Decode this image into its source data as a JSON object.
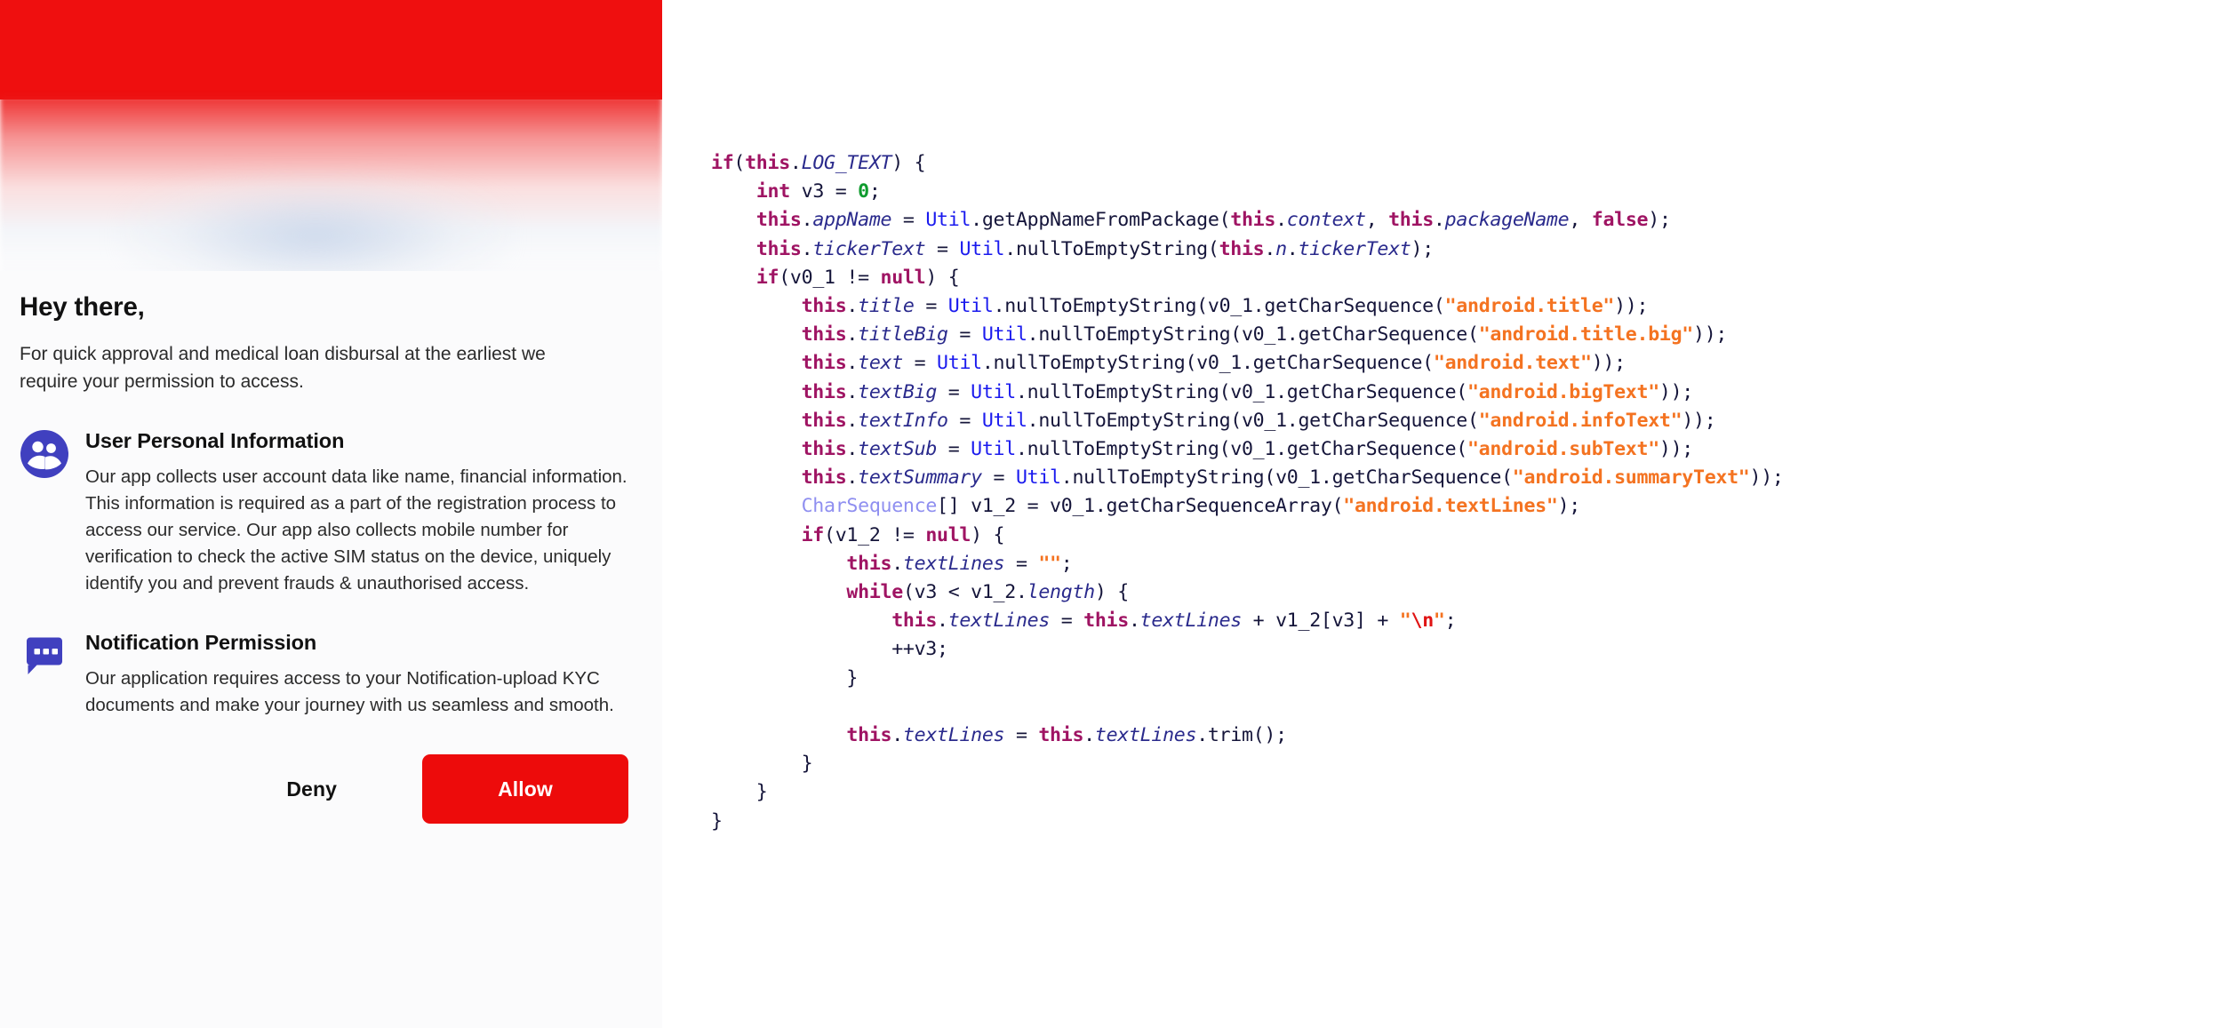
{
  "phone": {
    "hero": {
      "color": "#ef0f0f",
      "name": "red-gradient-banner"
    },
    "sheet": {
      "title": "Hey there,",
      "subtitle": "For quick approval and medical loan disbursal at the earliest we require your permission to access.",
      "permissions": [
        {
          "icon": "group-people-icon",
          "icon_color": "#4040bf",
          "heading": "User Personal Information",
          "description": "Our app collects user account data like name, financial information. This information is required as a part of the registration process to access our service. Our app also collects mobile number for verification to check the active SIM status on the device, uniquely identify you and prevent frauds & unauthorised access."
        },
        {
          "icon": "speech-bubble-dots-icon",
          "icon_color": "#4040bf",
          "heading": "Notification Permission",
          "description": "Our application requires access to your Notification-upload KYC documents and make your journey with us seamless and smooth."
        }
      ],
      "actions": {
        "deny_label": "Deny",
        "allow_label": "Allow",
        "allow_color": "#ed0b0b"
      }
    }
  },
  "code": {
    "language": "java",
    "colors": {
      "keyword": "#9f1463",
      "field": "#2a2a8c",
      "class": "#1a1aee",
      "type": "#8f8ff0",
      "string": "#f47321",
      "escape": "#e01414",
      "number": "#0f9b2e",
      "plain": "#15153a",
      "background": "#ffffff"
    },
    "lines": [
      [
        {
          "t": "kw",
          "v": "if"
        },
        {
          "t": "pl",
          "v": "("
        },
        {
          "t": "kw",
          "v": "this"
        },
        {
          "t": "pl",
          "v": "."
        },
        {
          "t": "fld",
          "v": "LOG_TEXT"
        },
        {
          "t": "pl",
          "v": ") {"
        }
      ],
      [
        {
          "t": "pl",
          "v": "    "
        },
        {
          "t": "kw",
          "v": "int"
        },
        {
          "t": "pl",
          "v": " v3 = "
        },
        {
          "t": "num",
          "v": "0"
        },
        {
          "t": "pl",
          "v": ";"
        }
      ],
      [
        {
          "t": "pl",
          "v": "    "
        },
        {
          "t": "kw",
          "v": "this"
        },
        {
          "t": "pl",
          "v": "."
        },
        {
          "t": "fld",
          "v": "appName"
        },
        {
          "t": "pl",
          "v": " = "
        },
        {
          "t": "cls",
          "v": "Util"
        },
        {
          "t": "pl",
          "v": ".getAppNameFromPackage("
        },
        {
          "t": "kw",
          "v": "this"
        },
        {
          "t": "pl",
          "v": "."
        },
        {
          "t": "fld",
          "v": "context"
        },
        {
          "t": "pl",
          "v": ", "
        },
        {
          "t": "kw",
          "v": "this"
        },
        {
          "t": "pl",
          "v": "."
        },
        {
          "t": "fld",
          "v": "packageName"
        },
        {
          "t": "pl",
          "v": ", "
        },
        {
          "t": "kw",
          "v": "false"
        },
        {
          "t": "pl",
          "v": ");"
        }
      ],
      [
        {
          "t": "pl",
          "v": "    "
        },
        {
          "t": "kw",
          "v": "this"
        },
        {
          "t": "pl",
          "v": "."
        },
        {
          "t": "fld",
          "v": "tickerText"
        },
        {
          "t": "pl",
          "v": " = "
        },
        {
          "t": "cls",
          "v": "Util"
        },
        {
          "t": "pl",
          "v": ".nullToEmptyString("
        },
        {
          "t": "kw",
          "v": "this"
        },
        {
          "t": "pl",
          "v": "."
        },
        {
          "t": "fld",
          "v": "n"
        },
        {
          "t": "pl",
          "v": "."
        },
        {
          "t": "fld",
          "v": "tickerText"
        },
        {
          "t": "pl",
          "v": ");"
        }
      ],
      [
        {
          "t": "pl",
          "v": "    "
        },
        {
          "t": "kw",
          "v": "if"
        },
        {
          "t": "pl",
          "v": "(v0_1 != "
        },
        {
          "t": "kw",
          "v": "null"
        },
        {
          "t": "pl",
          "v": ") {"
        }
      ],
      [
        {
          "t": "pl",
          "v": "        "
        },
        {
          "t": "kw",
          "v": "this"
        },
        {
          "t": "pl",
          "v": "."
        },
        {
          "t": "fld",
          "v": "title"
        },
        {
          "t": "pl",
          "v": " = "
        },
        {
          "t": "cls",
          "v": "Util"
        },
        {
          "t": "pl",
          "v": ".nullToEmptyString(v0_1.getCharSequence("
        },
        {
          "t": "str",
          "v": "\"android.title\""
        },
        {
          "t": "pl",
          "v": "));"
        }
      ],
      [
        {
          "t": "pl",
          "v": "        "
        },
        {
          "t": "kw",
          "v": "this"
        },
        {
          "t": "pl",
          "v": "."
        },
        {
          "t": "fld",
          "v": "titleBig"
        },
        {
          "t": "pl",
          "v": " = "
        },
        {
          "t": "cls",
          "v": "Util"
        },
        {
          "t": "pl",
          "v": ".nullToEmptyString(v0_1.getCharSequence("
        },
        {
          "t": "str",
          "v": "\"android.title.big\""
        },
        {
          "t": "pl",
          "v": "));"
        }
      ],
      [
        {
          "t": "pl",
          "v": "        "
        },
        {
          "t": "kw",
          "v": "this"
        },
        {
          "t": "pl",
          "v": "."
        },
        {
          "t": "fld",
          "v": "text"
        },
        {
          "t": "pl",
          "v": " = "
        },
        {
          "t": "cls",
          "v": "Util"
        },
        {
          "t": "pl",
          "v": ".nullToEmptyString(v0_1.getCharSequence("
        },
        {
          "t": "str",
          "v": "\"android.text\""
        },
        {
          "t": "pl",
          "v": "));"
        }
      ],
      [
        {
          "t": "pl",
          "v": "        "
        },
        {
          "t": "kw",
          "v": "this"
        },
        {
          "t": "pl",
          "v": "."
        },
        {
          "t": "fld",
          "v": "textBig"
        },
        {
          "t": "pl",
          "v": " = "
        },
        {
          "t": "cls",
          "v": "Util"
        },
        {
          "t": "pl",
          "v": ".nullToEmptyString(v0_1.getCharSequence("
        },
        {
          "t": "str",
          "v": "\"android.bigText\""
        },
        {
          "t": "pl",
          "v": "));"
        }
      ],
      [
        {
          "t": "pl",
          "v": "        "
        },
        {
          "t": "kw",
          "v": "this"
        },
        {
          "t": "pl",
          "v": "."
        },
        {
          "t": "fld",
          "v": "textInfo"
        },
        {
          "t": "pl",
          "v": " = "
        },
        {
          "t": "cls",
          "v": "Util"
        },
        {
          "t": "pl",
          "v": ".nullToEmptyString(v0_1.getCharSequence("
        },
        {
          "t": "str",
          "v": "\"android.infoText\""
        },
        {
          "t": "pl",
          "v": "));"
        }
      ],
      [
        {
          "t": "pl",
          "v": "        "
        },
        {
          "t": "kw",
          "v": "this"
        },
        {
          "t": "pl",
          "v": "."
        },
        {
          "t": "fld",
          "v": "textSub"
        },
        {
          "t": "pl",
          "v": " = "
        },
        {
          "t": "cls",
          "v": "Util"
        },
        {
          "t": "pl",
          "v": ".nullToEmptyString(v0_1.getCharSequence("
        },
        {
          "t": "str",
          "v": "\"android.subText\""
        },
        {
          "t": "pl",
          "v": "));"
        }
      ],
      [
        {
          "t": "pl",
          "v": "        "
        },
        {
          "t": "kw",
          "v": "this"
        },
        {
          "t": "pl",
          "v": "."
        },
        {
          "t": "fld",
          "v": "textSummary"
        },
        {
          "t": "pl",
          "v": " = "
        },
        {
          "t": "cls",
          "v": "Util"
        },
        {
          "t": "pl",
          "v": ".nullToEmptyString(v0_1.getCharSequence("
        },
        {
          "t": "str",
          "v": "\"android.summaryText\""
        },
        {
          "t": "pl",
          "v": "));"
        }
      ],
      [
        {
          "t": "pl",
          "v": "        "
        },
        {
          "t": "type",
          "v": "CharSequence"
        },
        {
          "t": "pl",
          "v": "[] v1_2 = v0_1.getCharSequenceArray("
        },
        {
          "t": "str",
          "v": "\"android.textLines\""
        },
        {
          "t": "pl",
          "v": ");"
        }
      ],
      [
        {
          "t": "pl",
          "v": "        "
        },
        {
          "t": "kw",
          "v": "if"
        },
        {
          "t": "pl",
          "v": "(v1_2 != "
        },
        {
          "t": "kw",
          "v": "null"
        },
        {
          "t": "pl",
          "v": ") {"
        }
      ],
      [
        {
          "t": "pl",
          "v": "            "
        },
        {
          "t": "kw",
          "v": "this"
        },
        {
          "t": "pl",
          "v": "."
        },
        {
          "t": "fld",
          "v": "textLines"
        },
        {
          "t": "pl",
          "v": " = "
        },
        {
          "t": "str",
          "v": "\"\""
        },
        {
          "t": "pl",
          "v": ";"
        }
      ],
      [
        {
          "t": "pl",
          "v": "            "
        },
        {
          "t": "kw",
          "v": "while"
        },
        {
          "t": "pl",
          "v": "(v3 < v1_2."
        },
        {
          "t": "fld",
          "v": "length"
        },
        {
          "t": "pl",
          "v": ") {"
        }
      ],
      [
        {
          "t": "pl",
          "v": "                "
        },
        {
          "t": "kw",
          "v": "this"
        },
        {
          "t": "pl",
          "v": "."
        },
        {
          "t": "fld",
          "v": "textLines"
        },
        {
          "t": "pl",
          "v": " = "
        },
        {
          "t": "kw",
          "v": "this"
        },
        {
          "t": "pl",
          "v": "."
        },
        {
          "t": "fld",
          "v": "textLines"
        },
        {
          "t": "pl",
          "v": " + v1_2[v3] + "
        },
        {
          "t": "str",
          "v": "\""
        },
        {
          "t": "esc",
          "v": "\\n"
        },
        {
          "t": "str",
          "v": "\""
        },
        {
          "t": "pl",
          "v": ";"
        }
      ],
      [
        {
          "t": "pl",
          "v": "                ++v3;"
        }
      ],
      [
        {
          "t": "pl",
          "v": "            }"
        }
      ],
      [
        {
          "t": "pl",
          "v": ""
        }
      ],
      [
        {
          "t": "pl",
          "v": "            "
        },
        {
          "t": "kw",
          "v": "this"
        },
        {
          "t": "pl",
          "v": "."
        },
        {
          "t": "fld",
          "v": "textLines"
        },
        {
          "t": "pl",
          "v": " = "
        },
        {
          "t": "kw",
          "v": "this"
        },
        {
          "t": "pl",
          "v": "."
        },
        {
          "t": "fld",
          "v": "textLines"
        },
        {
          "t": "pl",
          "v": ".trim();"
        }
      ],
      [
        {
          "t": "pl",
          "v": "        }"
        }
      ],
      [
        {
          "t": "pl",
          "v": "    }"
        }
      ],
      [
        {
          "t": "pl",
          "v": "}"
        }
      ]
    ]
  }
}
